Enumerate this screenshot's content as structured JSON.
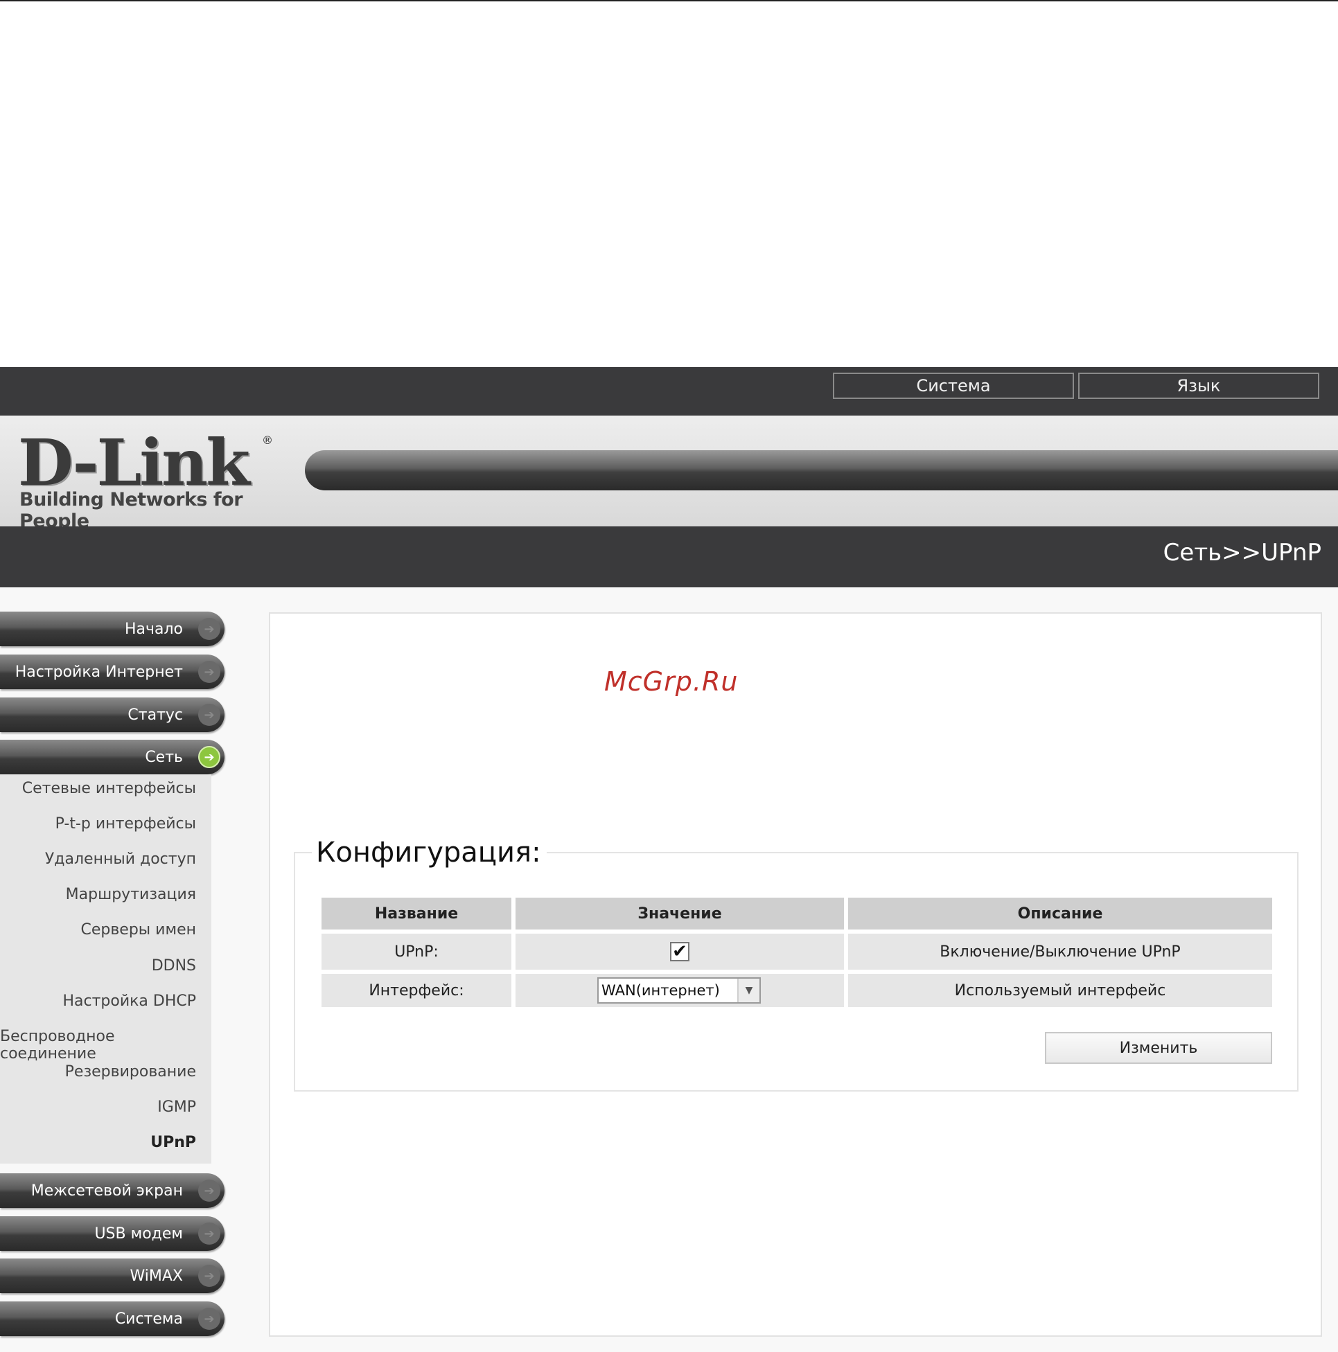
{
  "topbar": {
    "system_label": "Система",
    "language_label": "Язык"
  },
  "logo": {
    "brand": "D-Link",
    "registered": "®",
    "tagline": "Building Networks for People"
  },
  "breadcrumb": "Сеть>>UPnP",
  "watermark": "McGrp.Ru",
  "menu": {
    "home": "Начало",
    "internet_setup": "Настройка Интернет",
    "status": "Статус",
    "network": "Сеть",
    "firewall": "Межсетевой экран",
    "usb_modem": "USB модем",
    "wimax": "WiMAX",
    "system": "Система"
  },
  "submenu": [
    "Сетевые интерфейсы",
    "P-t-p интерфейсы",
    "Удаленный доступ",
    "Маршрутизация",
    "Серверы имен",
    "DDNS",
    "Настройка DHCP",
    "Беспроводное соединение",
    "Резервирование",
    "IGMP",
    "UPnP"
  ],
  "config": {
    "legend": "Конфигурация:",
    "headers": {
      "name": "Название",
      "value": "Значение",
      "description": "Описание"
    },
    "rows": [
      {
        "name": "UPnP:",
        "checked": true,
        "description": "Включение/Выключение UPnP"
      },
      {
        "name": "Интерфейс:",
        "selected": "WAN(интернет)",
        "description": "Используемый интерфейс"
      }
    ],
    "apply_label": "Изменить"
  },
  "icons": {
    "menu_arrow": "arrow-right-icon",
    "checkmark": "checkmark-icon",
    "dropdown": "chevron-down-icon"
  },
  "colors": {
    "topbar": "#3a3a3c",
    "active_arrow": "#8dc63f",
    "watermark": "#c0302a"
  }
}
